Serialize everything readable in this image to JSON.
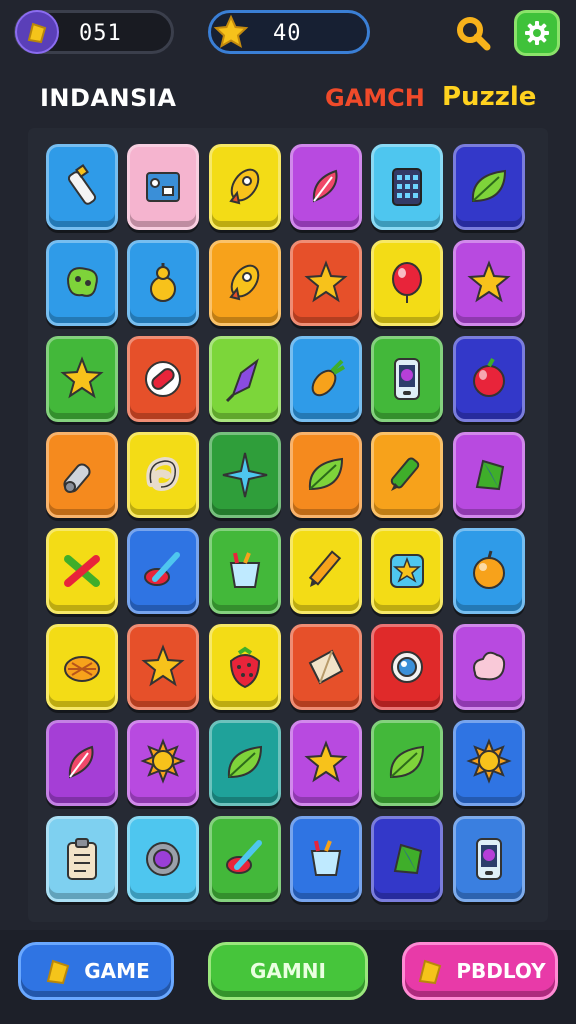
{
  "header": {
    "coins": {
      "icon": "gold-ticket-icon",
      "value": "051"
    },
    "stars": {
      "icon": "star-icon",
      "value": "40"
    },
    "search_icon": "search-icon",
    "settings_icon": "gear-icon"
  },
  "title_row": {
    "left": "INDANSIA",
    "right_red": "GAMCH",
    "right_yellow": "Puzzle"
  },
  "board": {
    "rows": [
      [
        {
          "color": "#2f9be8",
          "icon": "bottle-icon"
        },
        {
          "color": "#f5b4cf",
          "icon": "box-icon"
        },
        {
          "color": "#f3dc16",
          "icon": "rocket-icon"
        },
        {
          "color": "#b84ae0",
          "icon": "feather-icon"
        },
        {
          "color": "#4ec6ef",
          "icon": "calculator-icon"
        },
        {
          "color": "#3338c9",
          "icon": "leaf-icon"
        }
      ],
      [
        {
          "color": "#2f9be8",
          "icon": "blob-icon"
        },
        {
          "color": "#2f9be8",
          "icon": "gourd-icon"
        },
        {
          "color": "#f7a21b",
          "icon": "rocket-icon"
        },
        {
          "color": "#e6502a",
          "icon": "star-icon"
        },
        {
          "color": "#f3dc16",
          "icon": "balloon-icon"
        },
        {
          "color": "#b84ae0",
          "icon": "star-icon"
        }
      ],
      [
        {
          "color": "#43b83a",
          "icon": "star-icon"
        },
        {
          "color": "#e6502a",
          "icon": "pills-icon"
        },
        {
          "color": "#7cd63a",
          "icon": "kite-icon"
        },
        {
          "color": "#2f9be8",
          "icon": "corn-icon"
        },
        {
          "color": "#43b83a",
          "icon": "phone-icon"
        },
        {
          "color": "#3338c9",
          "icon": "apple-icon"
        }
      ],
      [
        {
          "color": "#f58a1e",
          "icon": "cannon-icon"
        },
        {
          "color": "#f3dc16",
          "icon": "pretzel-icon"
        },
        {
          "color": "#2f9e3a",
          "icon": "sparkle-icon"
        },
        {
          "color": "#f58a1e",
          "icon": "leaf-icon"
        },
        {
          "color": "#f7a21b",
          "icon": "marker-icon"
        },
        {
          "color": "#b84ae0",
          "icon": "gem-icon"
        }
      ],
      [
        {
          "color": "#f3dc16",
          "icon": "cross-icon"
        },
        {
          "color": "#2f74e3",
          "icon": "pen-icon"
        },
        {
          "color": "#43b83a",
          "icon": "basket-icon"
        },
        {
          "color": "#f3dc16",
          "icon": "pencil-icon"
        },
        {
          "color": "#f3dc16",
          "icon": "splat-icon"
        },
        {
          "color": "#2f9be8",
          "icon": "orange-icon"
        }
      ],
      [
        {
          "color": "#f3dc16",
          "icon": "shell-icon"
        },
        {
          "color": "#e6502a",
          "icon": "star-icon"
        },
        {
          "color": "#f3dc16",
          "icon": "strawberry-icon"
        },
        {
          "color": "#e6502a",
          "icon": "bag-icon"
        },
        {
          "color": "#e02a2a",
          "icon": "flower-icon"
        },
        {
          "color": "#b84ae0",
          "icon": "cloud-icon"
        }
      ],
      [
        {
          "color": "#a53ed6",
          "icon": "feather-icon"
        },
        {
          "color": "#b84ae0",
          "icon": "sun-icon"
        },
        {
          "color": "#1fa29a",
          "icon": "leaf-icon"
        },
        {
          "color": "#b84ae0",
          "icon": "star-icon"
        },
        {
          "color": "#43b83a",
          "icon": "leaf-icon"
        },
        {
          "color": "#2f74e3",
          "icon": "sun-icon"
        }
      ],
      [
        {
          "color": "#7ed0f0",
          "icon": "clipboard-icon"
        },
        {
          "color": "#4ec6ef",
          "icon": "gear-icon"
        },
        {
          "color": "#43b83a",
          "icon": "pen-icon"
        },
        {
          "color": "#2f74e3",
          "icon": "basket-icon"
        },
        {
          "color": "#3338c9",
          "icon": "gem-icon"
        },
        {
          "color": "#3a7fe0",
          "icon": "phone-icon"
        }
      ]
    ]
  },
  "bottom": {
    "game_label": "GAME",
    "game_icon": "gold-ticket-icon",
    "gamni_label": "GAMNI",
    "pbdloy_label": "PBDLOY",
    "pbdloy_icon": "gold-ticket-icon"
  }
}
